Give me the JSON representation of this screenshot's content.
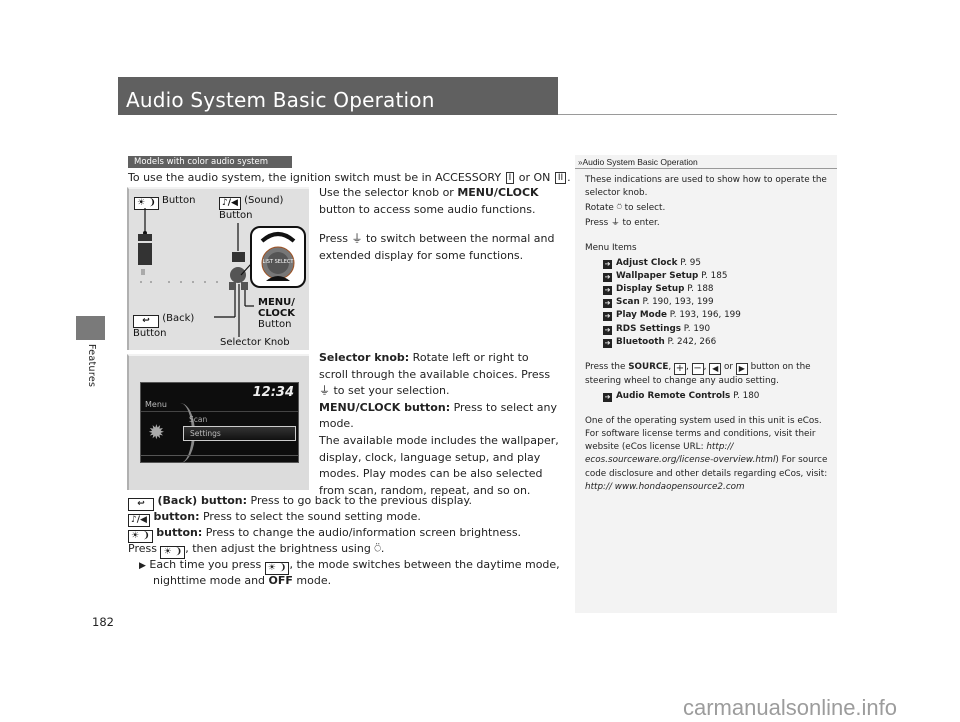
{
  "section": {
    "label": "Features"
  },
  "page": {
    "title": "Audio System Basic Operation",
    "number": "182"
  },
  "models_tag": "Models with color audio system",
  "intro": {
    "text_before": "To use the audio system, the ignition switch must be in ACCESSORY",
    "accessory_key": "I",
    "or": "or ON",
    "on_key": "II",
    "end": "."
  },
  "paragraphs": {
    "p1_a": "Use the selector knob or ",
    "p1_bold": "MENU/CLOCK",
    "p1_b": " button to access some audio functions.",
    "p2_a": "Press ",
    "p2_b": " to switch between the normal and extended display for some functions.",
    "selector_label": "Selector knob:",
    "selector_a": " Rotate left or right to scroll through the available choices. Press ",
    "selector_b": " to set your selection.",
    "menu_label": "MENU/CLOCK button:",
    "menu_text": " Press to select any mode.",
    "modes_text": "The available mode includes the wallpaper, display, clock, language setup, and play modes. Play modes can be also selected from scan, random, repeat, and so on."
  },
  "figure1": {
    "brightness_label": "Button",
    "sound_label": "(Sound)",
    "sound_label2": "Button",
    "back_label": "(Back)",
    "back_label2": "Button",
    "menu_label1": "MENU/",
    "menu_label2": "CLOCK",
    "menu_label3": "Button",
    "knob_label": "Selector Knob",
    "knob_text": "LIST SELECT"
  },
  "figure2": {
    "clock": "12:34",
    "menu": "Menu",
    "item1": "Scan",
    "item2": "Settings"
  },
  "buttons": {
    "back_label": "(Back) button:",
    "back_text": " Press to go back to the previous display.",
    "sound_label": "button:",
    "sound_text": " Press to select the sound setting mode.",
    "bright_label": "button:",
    "bright_text": " Press to change the audio/information screen brightness.",
    "press": "Press ",
    "press_then": ", then adjust the brightness using ",
    "press_end": ".",
    "each_a": "Each time you press ",
    "each_b": ", the mode switches between the daytime mode,",
    "each_c": "nighttime mode and ",
    "off": "OFF",
    "each_d": " mode."
  },
  "sidebar": {
    "heading": "Audio System Basic Operation",
    "intro": "These indications are used to show how to operate the selector knob.",
    "rotate_a": "Rotate ",
    "rotate_b": " to select.",
    "press_a": "Press ",
    "press_b": " to enter.",
    "menu_items_label": "Menu Items",
    "menu_items": [
      {
        "name": "Adjust Clock",
        "pages": "P. 95"
      },
      {
        "name": "Wallpaper Setup",
        "pages": "P. 185"
      },
      {
        "name": "Display Setup",
        "pages": "P. 188"
      },
      {
        "name": "Scan",
        "pages": "P. 190, 193, 199"
      },
      {
        "name": "Play Mode",
        "pages": "P. 193, 196, 199"
      },
      {
        "name": "RDS Settings",
        "pages": "P. 190"
      },
      {
        "name": "Bluetooth",
        "pages": "P. 242, 266"
      }
    ],
    "steering_a": "Press the ",
    "steering_source": "SOURCE",
    "steering_or": "or",
    "steering_b": "button on the steering wheel to change any audio setting.",
    "remote_name": "Audio Remote Controls",
    "remote_page": "P. 180",
    "ecos_1": "One of the operating system used in this unit is eCos. For software license terms and conditions, visit their website (eCos license URL: ",
    "ecos_url": "http:// ecos.sourceware.org/license-overview.html",
    "ecos_2": ")",
    "source_1": "For source code disclosure and other details regarding eCos, visit: ",
    "source_url": "http:// www.hondaopensource2.com"
  },
  "icons": {
    "brightness": "☀",
    "moon": "❩",
    "sound": "♪/◀",
    "back": "↩",
    "press_knob": "⏚",
    "rotate_knob": "⍥",
    "arrow": "➔",
    "plus": "+",
    "minus": "−",
    "left": "◀",
    "right": "▶",
    "triangle": "▶",
    "gear": "✹"
  },
  "watermark": "carmanualsonline.info"
}
